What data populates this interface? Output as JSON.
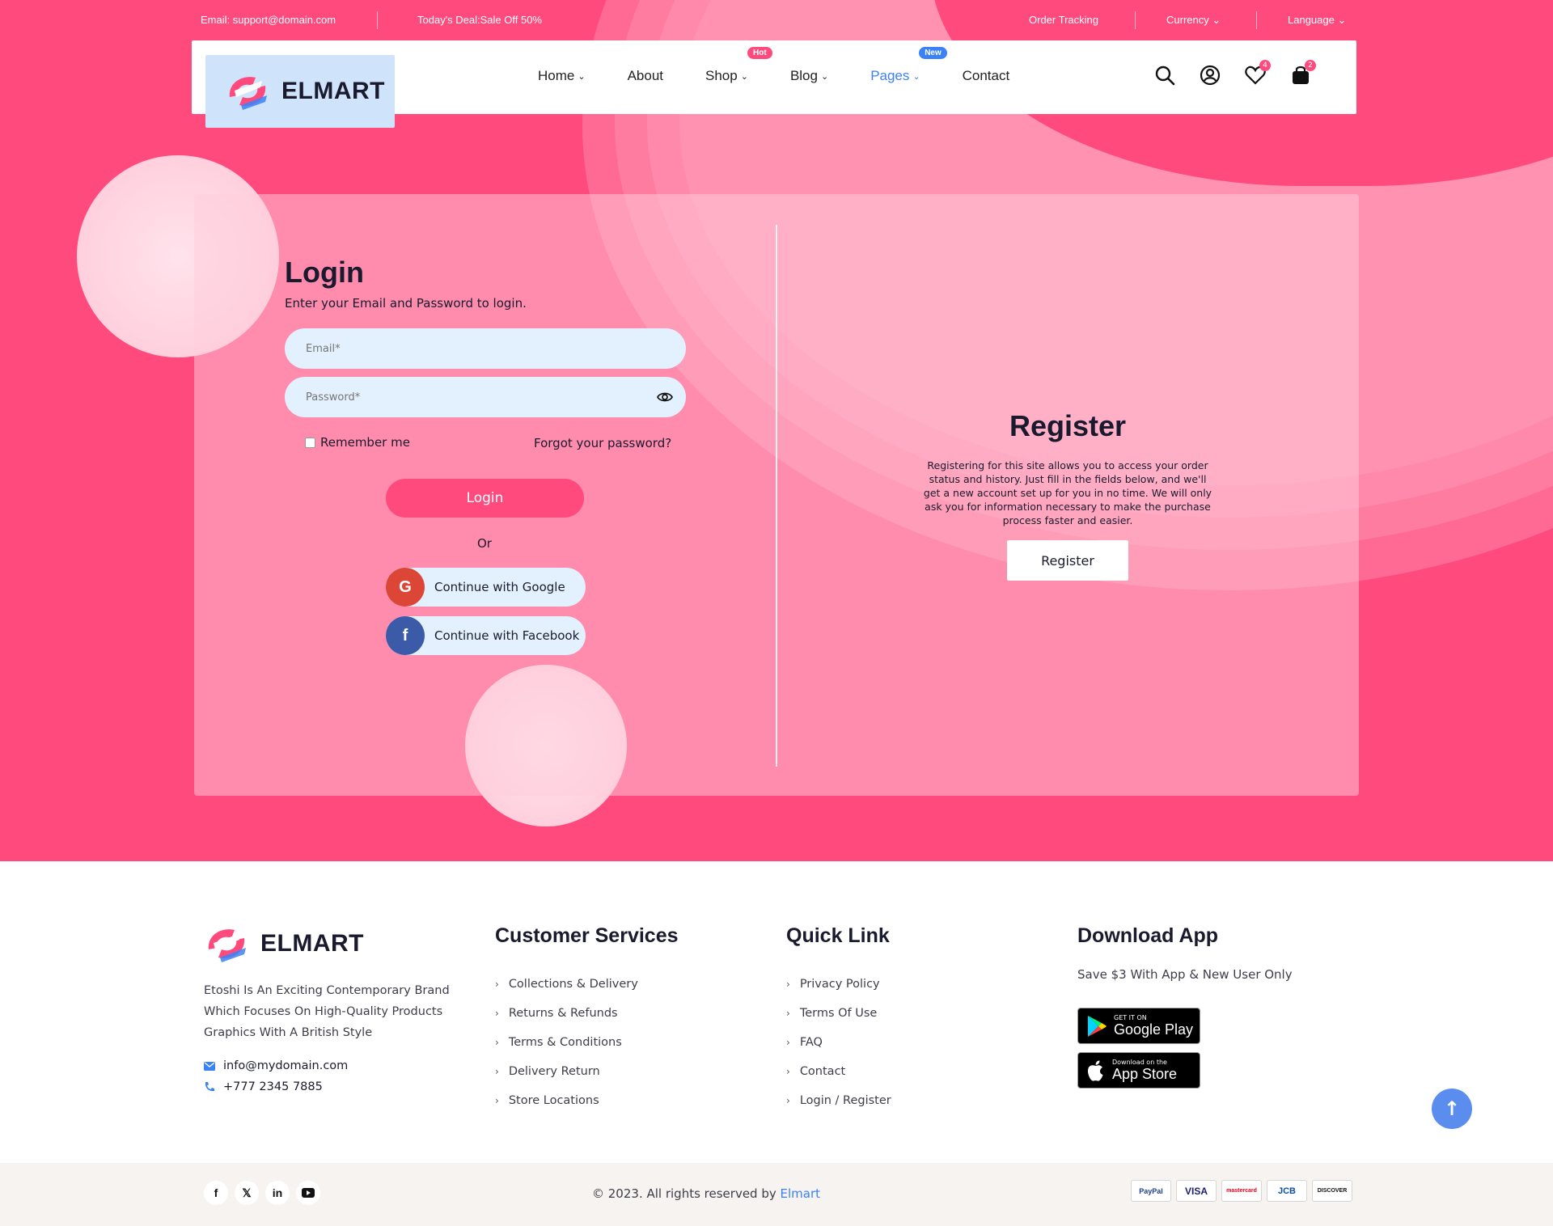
{
  "topbar": {
    "email": "Email: support@domain.com",
    "deal": "Today's Deal:Sale Off 50%",
    "order_tracking": "Order Tracking",
    "currency": "Currency",
    "language": "Language"
  },
  "brand": {
    "name": "ELMART"
  },
  "nav": {
    "items": [
      {
        "label": "Home",
        "dropdown": true
      },
      {
        "label": "About"
      },
      {
        "label": "Shop",
        "dropdown": true,
        "badge": "Hot"
      },
      {
        "label": "Blog",
        "dropdown": true
      },
      {
        "label": "Pages",
        "dropdown": true,
        "badge": "New",
        "active": true
      },
      {
        "label": "Contact"
      }
    ],
    "icons": [
      "search-icon",
      "user-icon",
      "heart-icon",
      "bag-icon"
    ],
    "wishlist_count": "4",
    "cart_count": "2"
  },
  "login": {
    "title": "Login",
    "subtitle": "Enter your Email and Password to login.",
    "email_placeholder": "Email*",
    "password_placeholder": "Password*",
    "remember": "Remember me",
    "forgot": "Forgot your password?",
    "button": "Login",
    "or": "Or",
    "google": "Continue with Google",
    "facebook": "Continue with Facebook"
  },
  "register": {
    "title": "Register",
    "text": "Registering for this site allows you to access your order status and history. Just fill in the fields below, and we'll get a new account set up for you in no time. We will only ask you for information necessary to make the purchase process faster and easier.",
    "button": "Register"
  },
  "footer": {
    "about": "Etoshi Is An Exciting Contemporary Brand Which Focuses On High-Quality Products Graphics With A British Style",
    "email": "info@mydomain.com",
    "phone": "+777 2345 7885",
    "customer_services": {
      "title": "Customer Services",
      "links": [
        "Collections & Delivery",
        "Returns & Refunds",
        "Terms & Conditions",
        "Delivery Return",
        "Store Locations"
      ]
    },
    "quick_link": {
      "title": "Quick Link",
      "links": [
        "Privacy Policy",
        "Terms Of Use",
        "FAQ",
        "Contact",
        "Login / Register"
      ]
    },
    "download": {
      "title": "Download App",
      "subtitle": "Save $3 With App & New User Only",
      "google_small": "GET IT ON",
      "google_big": "Google Play",
      "apple_small": "Download on the",
      "apple_big": "App Store"
    },
    "copyright_prefix": "© 2023. All rights reserved by ",
    "copyright_brand": "Elmart",
    "payments": [
      "PayPal",
      "VISA",
      "mastercard",
      "JCB",
      "DISCOVER"
    ]
  },
  "colors": {
    "primary": "#ff4a7e",
    "accent": "#3b82f6",
    "field_bg": "#e3f0fd"
  }
}
